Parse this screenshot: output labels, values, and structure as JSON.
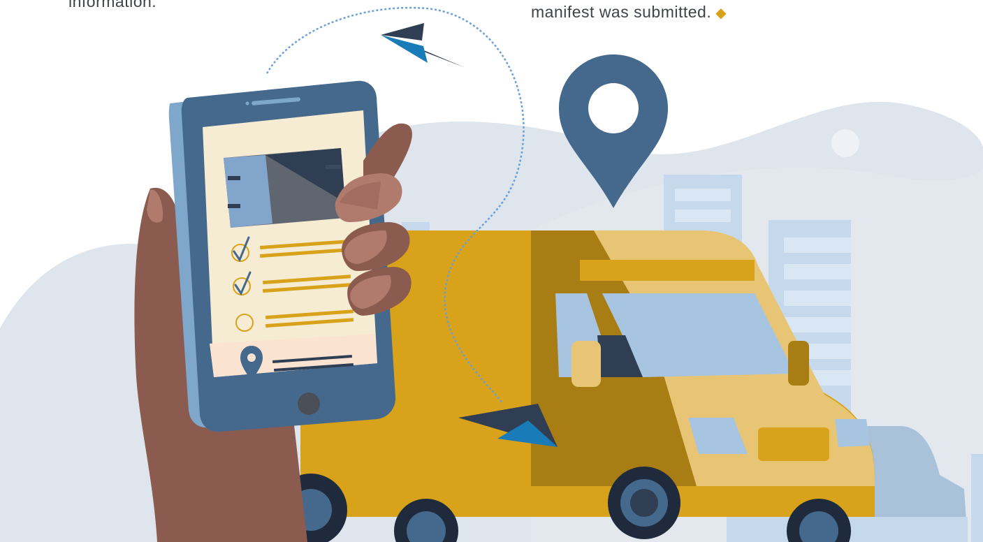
{
  "captions": {
    "left_text": "information.",
    "right_text": "manifest was submitted.",
    "right_marker": "◆"
  },
  "colors": {
    "background": "#ffffff",
    "hill": "#d9e0e8",
    "building": "#c6d9ec",
    "van_body": "#d8a21a",
    "van_shadow": "#a87d14",
    "van_cab": "#e8c574",
    "glass": "#a7c5e1",
    "phone_frame": "#45688d",
    "phone_screen": "#f6ecd3",
    "skin": "#8b5b4f",
    "pin": "#45688d",
    "flight_path": "#6a9fd8",
    "text": "#3f434a",
    "accent_marker": "#d8a21a"
  },
  "illustration": {
    "phone_checklist": {
      "items": [
        {
          "status": "checked"
        },
        {
          "status": "checked"
        },
        {
          "status": "unchecked"
        }
      ]
    },
    "icons": [
      "phone-icon",
      "location-pin-icon",
      "paper-plane-icon",
      "delivery-van-icon",
      "checkmark-icon"
    ]
  }
}
